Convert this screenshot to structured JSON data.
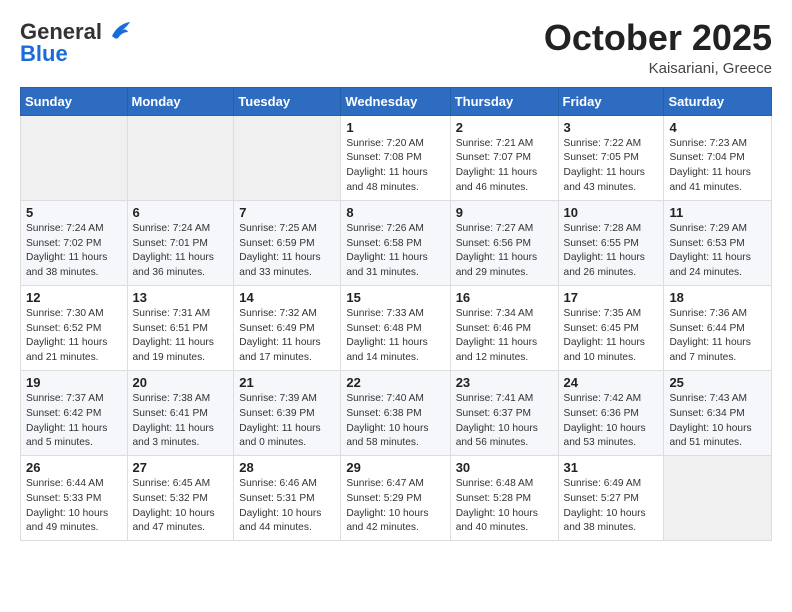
{
  "header": {
    "logo_general": "General",
    "logo_blue": "Blue",
    "month": "October 2025",
    "location": "Kaisariani, Greece"
  },
  "columns": [
    "Sunday",
    "Monday",
    "Tuesday",
    "Wednesday",
    "Thursday",
    "Friday",
    "Saturday"
  ],
  "rows": [
    [
      {
        "day": "",
        "info": ""
      },
      {
        "day": "",
        "info": ""
      },
      {
        "day": "",
        "info": ""
      },
      {
        "day": "1",
        "info": "Sunrise: 7:20 AM\nSunset: 7:08 PM\nDaylight: 11 hours and 48 minutes."
      },
      {
        "day": "2",
        "info": "Sunrise: 7:21 AM\nSunset: 7:07 PM\nDaylight: 11 hours and 46 minutes."
      },
      {
        "day": "3",
        "info": "Sunrise: 7:22 AM\nSunset: 7:05 PM\nDaylight: 11 hours and 43 minutes."
      },
      {
        "day": "4",
        "info": "Sunrise: 7:23 AM\nSunset: 7:04 PM\nDaylight: 11 hours and 41 minutes."
      }
    ],
    [
      {
        "day": "5",
        "info": "Sunrise: 7:24 AM\nSunset: 7:02 PM\nDaylight: 11 hours and 38 minutes."
      },
      {
        "day": "6",
        "info": "Sunrise: 7:24 AM\nSunset: 7:01 PM\nDaylight: 11 hours and 36 minutes."
      },
      {
        "day": "7",
        "info": "Sunrise: 7:25 AM\nSunset: 6:59 PM\nDaylight: 11 hours and 33 minutes."
      },
      {
        "day": "8",
        "info": "Sunrise: 7:26 AM\nSunset: 6:58 PM\nDaylight: 11 hours and 31 minutes."
      },
      {
        "day": "9",
        "info": "Sunrise: 7:27 AM\nSunset: 6:56 PM\nDaylight: 11 hours and 29 minutes."
      },
      {
        "day": "10",
        "info": "Sunrise: 7:28 AM\nSunset: 6:55 PM\nDaylight: 11 hours and 26 minutes."
      },
      {
        "day": "11",
        "info": "Sunrise: 7:29 AM\nSunset: 6:53 PM\nDaylight: 11 hours and 24 minutes."
      }
    ],
    [
      {
        "day": "12",
        "info": "Sunrise: 7:30 AM\nSunset: 6:52 PM\nDaylight: 11 hours and 21 minutes."
      },
      {
        "day": "13",
        "info": "Sunrise: 7:31 AM\nSunset: 6:51 PM\nDaylight: 11 hours and 19 minutes."
      },
      {
        "day": "14",
        "info": "Sunrise: 7:32 AM\nSunset: 6:49 PM\nDaylight: 11 hours and 17 minutes."
      },
      {
        "day": "15",
        "info": "Sunrise: 7:33 AM\nSunset: 6:48 PM\nDaylight: 11 hours and 14 minutes."
      },
      {
        "day": "16",
        "info": "Sunrise: 7:34 AM\nSunset: 6:46 PM\nDaylight: 11 hours and 12 minutes."
      },
      {
        "day": "17",
        "info": "Sunrise: 7:35 AM\nSunset: 6:45 PM\nDaylight: 11 hours and 10 minutes."
      },
      {
        "day": "18",
        "info": "Sunrise: 7:36 AM\nSunset: 6:44 PM\nDaylight: 11 hours and 7 minutes."
      }
    ],
    [
      {
        "day": "19",
        "info": "Sunrise: 7:37 AM\nSunset: 6:42 PM\nDaylight: 11 hours and 5 minutes."
      },
      {
        "day": "20",
        "info": "Sunrise: 7:38 AM\nSunset: 6:41 PM\nDaylight: 11 hours and 3 minutes."
      },
      {
        "day": "21",
        "info": "Sunrise: 7:39 AM\nSunset: 6:39 PM\nDaylight: 11 hours and 0 minutes."
      },
      {
        "day": "22",
        "info": "Sunrise: 7:40 AM\nSunset: 6:38 PM\nDaylight: 10 hours and 58 minutes."
      },
      {
        "day": "23",
        "info": "Sunrise: 7:41 AM\nSunset: 6:37 PM\nDaylight: 10 hours and 56 minutes."
      },
      {
        "day": "24",
        "info": "Sunrise: 7:42 AM\nSunset: 6:36 PM\nDaylight: 10 hours and 53 minutes."
      },
      {
        "day": "25",
        "info": "Sunrise: 7:43 AM\nSunset: 6:34 PM\nDaylight: 10 hours and 51 minutes."
      }
    ],
    [
      {
        "day": "26",
        "info": "Sunrise: 6:44 AM\nSunset: 5:33 PM\nDaylight: 10 hours and 49 minutes."
      },
      {
        "day": "27",
        "info": "Sunrise: 6:45 AM\nSunset: 5:32 PM\nDaylight: 10 hours and 47 minutes."
      },
      {
        "day": "28",
        "info": "Sunrise: 6:46 AM\nSunset: 5:31 PM\nDaylight: 10 hours and 44 minutes."
      },
      {
        "day": "29",
        "info": "Sunrise: 6:47 AM\nSunset: 5:29 PM\nDaylight: 10 hours and 42 minutes."
      },
      {
        "day": "30",
        "info": "Sunrise: 6:48 AM\nSunset: 5:28 PM\nDaylight: 10 hours and 40 minutes."
      },
      {
        "day": "31",
        "info": "Sunrise: 6:49 AM\nSunset: 5:27 PM\nDaylight: 10 hours and 38 minutes."
      },
      {
        "day": "",
        "info": ""
      }
    ]
  ]
}
